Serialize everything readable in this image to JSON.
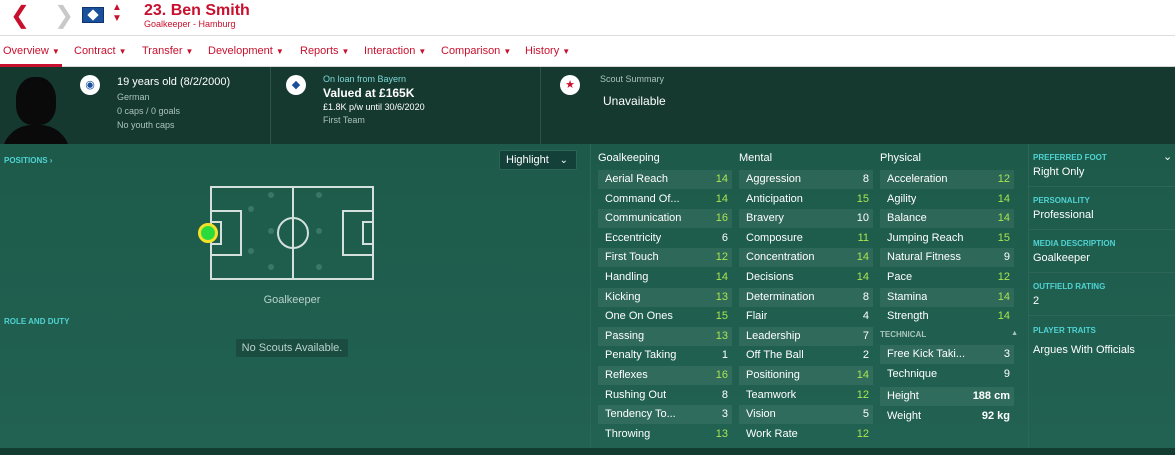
{
  "header": {
    "player_name": "23. Ben Smith",
    "player_sub": "Goalkeeper - Hamburg"
  },
  "tabs": [
    {
      "label": "Overview"
    },
    {
      "label": "Contract"
    },
    {
      "label": "Transfer"
    },
    {
      "label": "Development"
    },
    {
      "label": "Reports"
    },
    {
      "label": "Interaction"
    },
    {
      "label": "Comparison"
    },
    {
      "label": "History"
    }
  ],
  "info": {
    "age": "19 years old (8/2/2000)",
    "nationality": "German",
    "caps": "0 caps / 0 goals",
    "youth_caps": "No youth caps",
    "loan": "On loan from Bayern",
    "valued": "Valued at £165K",
    "wage": "£1.8K p/w until 30/6/2020",
    "squad": "First Team",
    "scout_label": "Scout Summary",
    "scout_value": "Unavailable"
  },
  "left": {
    "positions_label": "POSITIONS ›",
    "highlight_label": "Highlight",
    "position_text": "Goalkeeper",
    "role_label": "ROLE AND DUTY",
    "no_scouts": "No Scouts Available."
  },
  "attributes": {
    "goalkeeping": {
      "title": "Goalkeeping",
      "rows": [
        {
          "name": "Aerial Reach",
          "value": "14"
        },
        {
          "name": "Command Of...",
          "value": "14"
        },
        {
          "name": "Communication",
          "value": "16"
        },
        {
          "name": "Eccentricity",
          "value": "6"
        },
        {
          "name": "First Touch",
          "value": "12"
        },
        {
          "name": "Handling",
          "value": "14"
        },
        {
          "name": "Kicking",
          "value": "13"
        },
        {
          "name": "One On Ones",
          "value": "15"
        },
        {
          "name": "Passing",
          "value": "13"
        },
        {
          "name": "Penalty Taking",
          "value": "1"
        },
        {
          "name": "Reflexes",
          "value": "16"
        },
        {
          "name": "Rushing Out",
          "value": "8"
        },
        {
          "name": "Tendency To...",
          "value": "3"
        },
        {
          "name": "Throwing",
          "value": "13"
        }
      ]
    },
    "mental": {
      "title": "Mental",
      "rows": [
        {
          "name": "Aggression",
          "value": "8"
        },
        {
          "name": "Anticipation",
          "value": "15"
        },
        {
          "name": "Bravery",
          "value": "10"
        },
        {
          "name": "Composure",
          "value": "11"
        },
        {
          "name": "Concentration",
          "value": "14"
        },
        {
          "name": "Decisions",
          "value": "14"
        },
        {
          "name": "Determination",
          "value": "8"
        },
        {
          "name": "Flair",
          "value": "4"
        },
        {
          "name": "Leadership",
          "value": "7"
        },
        {
          "name": "Off The Ball",
          "value": "2"
        },
        {
          "name": "Positioning",
          "value": "14"
        },
        {
          "name": "Teamwork",
          "value": "12"
        },
        {
          "name": "Vision",
          "value": "5"
        },
        {
          "name": "Work Rate",
          "value": "12"
        }
      ]
    },
    "physical": {
      "title": "Physical",
      "rows": [
        {
          "name": "Acceleration",
          "value": "12"
        },
        {
          "name": "Agility",
          "value": "14"
        },
        {
          "name": "Balance",
          "value": "14"
        },
        {
          "name": "Jumping Reach",
          "value": "15"
        },
        {
          "name": "Natural Fitness",
          "value": "9"
        },
        {
          "name": "Pace",
          "value": "12"
        },
        {
          "name": "Stamina",
          "value": "14"
        },
        {
          "name": "Strength",
          "value": "14"
        }
      ]
    },
    "technical": {
      "title": "TECHNICAL",
      "rows": [
        {
          "name": "Free Kick Taki...",
          "value": "3"
        },
        {
          "name": "Technique",
          "value": "9"
        }
      ]
    },
    "measures": [
      {
        "name": "Height",
        "value": "188 cm"
      },
      {
        "name": "Weight",
        "value": "92 kg"
      }
    ]
  },
  "side": {
    "foot_label": "PREFERRED FOOT",
    "foot_value": "Right Only",
    "personality_label": "PERSONALITY",
    "personality_value": "Professional",
    "media_label": "MEDIA DESCRIPTION",
    "media_value": "Goalkeeper",
    "outfield_label": "OUTFIELD RATING",
    "outfield_value": "2",
    "traits_label": "PLAYER TRAITS",
    "traits_value": "Argues With Officials"
  },
  "colors": {
    "accent": "#c8102e",
    "value_green": "#a8e650",
    "section_cyan": "#4fd3d3"
  }
}
